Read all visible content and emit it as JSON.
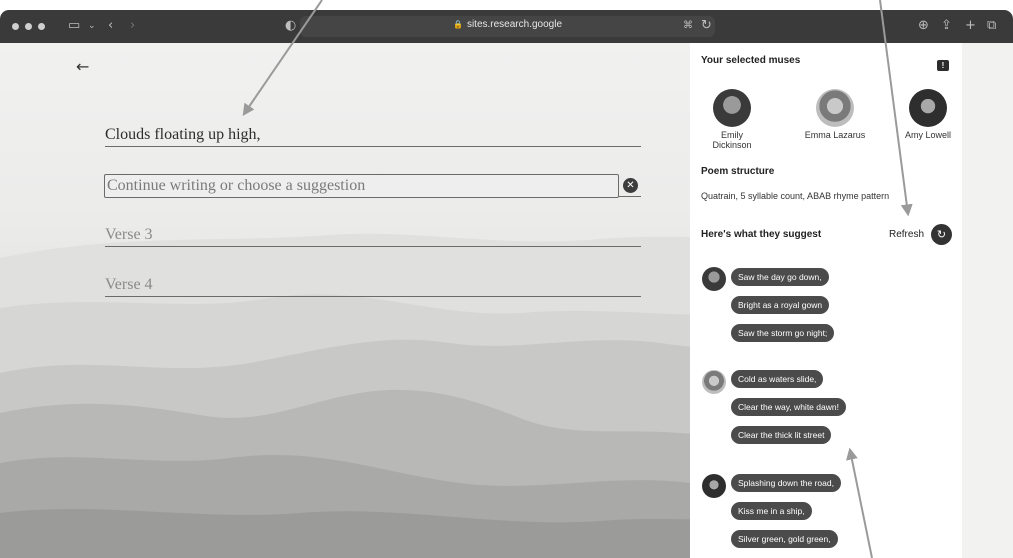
{
  "browser": {
    "url": "sites.research.google"
  },
  "verses": [
    {
      "text": "Clouds floating up high,",
      "state": "filled"
    },
    {
      "placeholder": "Continue writing or choose a suggestion",
      "state": "active"
    },
    {
      "text": "Verse 3",
      "state": "empty"
    },
    {
      "text": "Verse 4",
      "state": "empty"
    }
  ],
  "panel": {
    "muses_title": "Your selected muses",
    "muses": [
      {
        "name": "Emily Dickinson",
        "line1": "Emily",
        "line2": "Dickinson"
      },
      {
        "name": "Emma Lazarus"
      },
      {
        "name": "Amy Lowell"
      }
    ],
    "structure_title": "Poem structure",
    "structure_text": "Quatrain, 5 syllable count, ABAB rhyme pattern",
    "suggest_title": "Here's what they suggest",
    "refresh_label": "Refresh",
    "suggestions": [
      {
        "muse": "Emily Dickinson",
        "lines": [
          "Saw the day go down,",
          "Bright as a royal gown",
          "Saw the storm go night;"
        ]
      },
      {
        "muse": "Emma Lazarus",
        "lines": [
          "Cold as waters slide,",
          "Clear the way, white dawn!",
          "Clear the thick lit street"
        ]
      },
      {
        "muse": "Amy Lowell",
        "lines": [
          "Splashing down the road,",
          "Kiss me in a ship,",
          "Silver green, gold green,"
        ]
      }
    ]
  },
  "colors": {
    "chrome": "#3a3a3a",
    "chip": "#4b4b4b",
    "panel": "#ffffff"
  }
}
